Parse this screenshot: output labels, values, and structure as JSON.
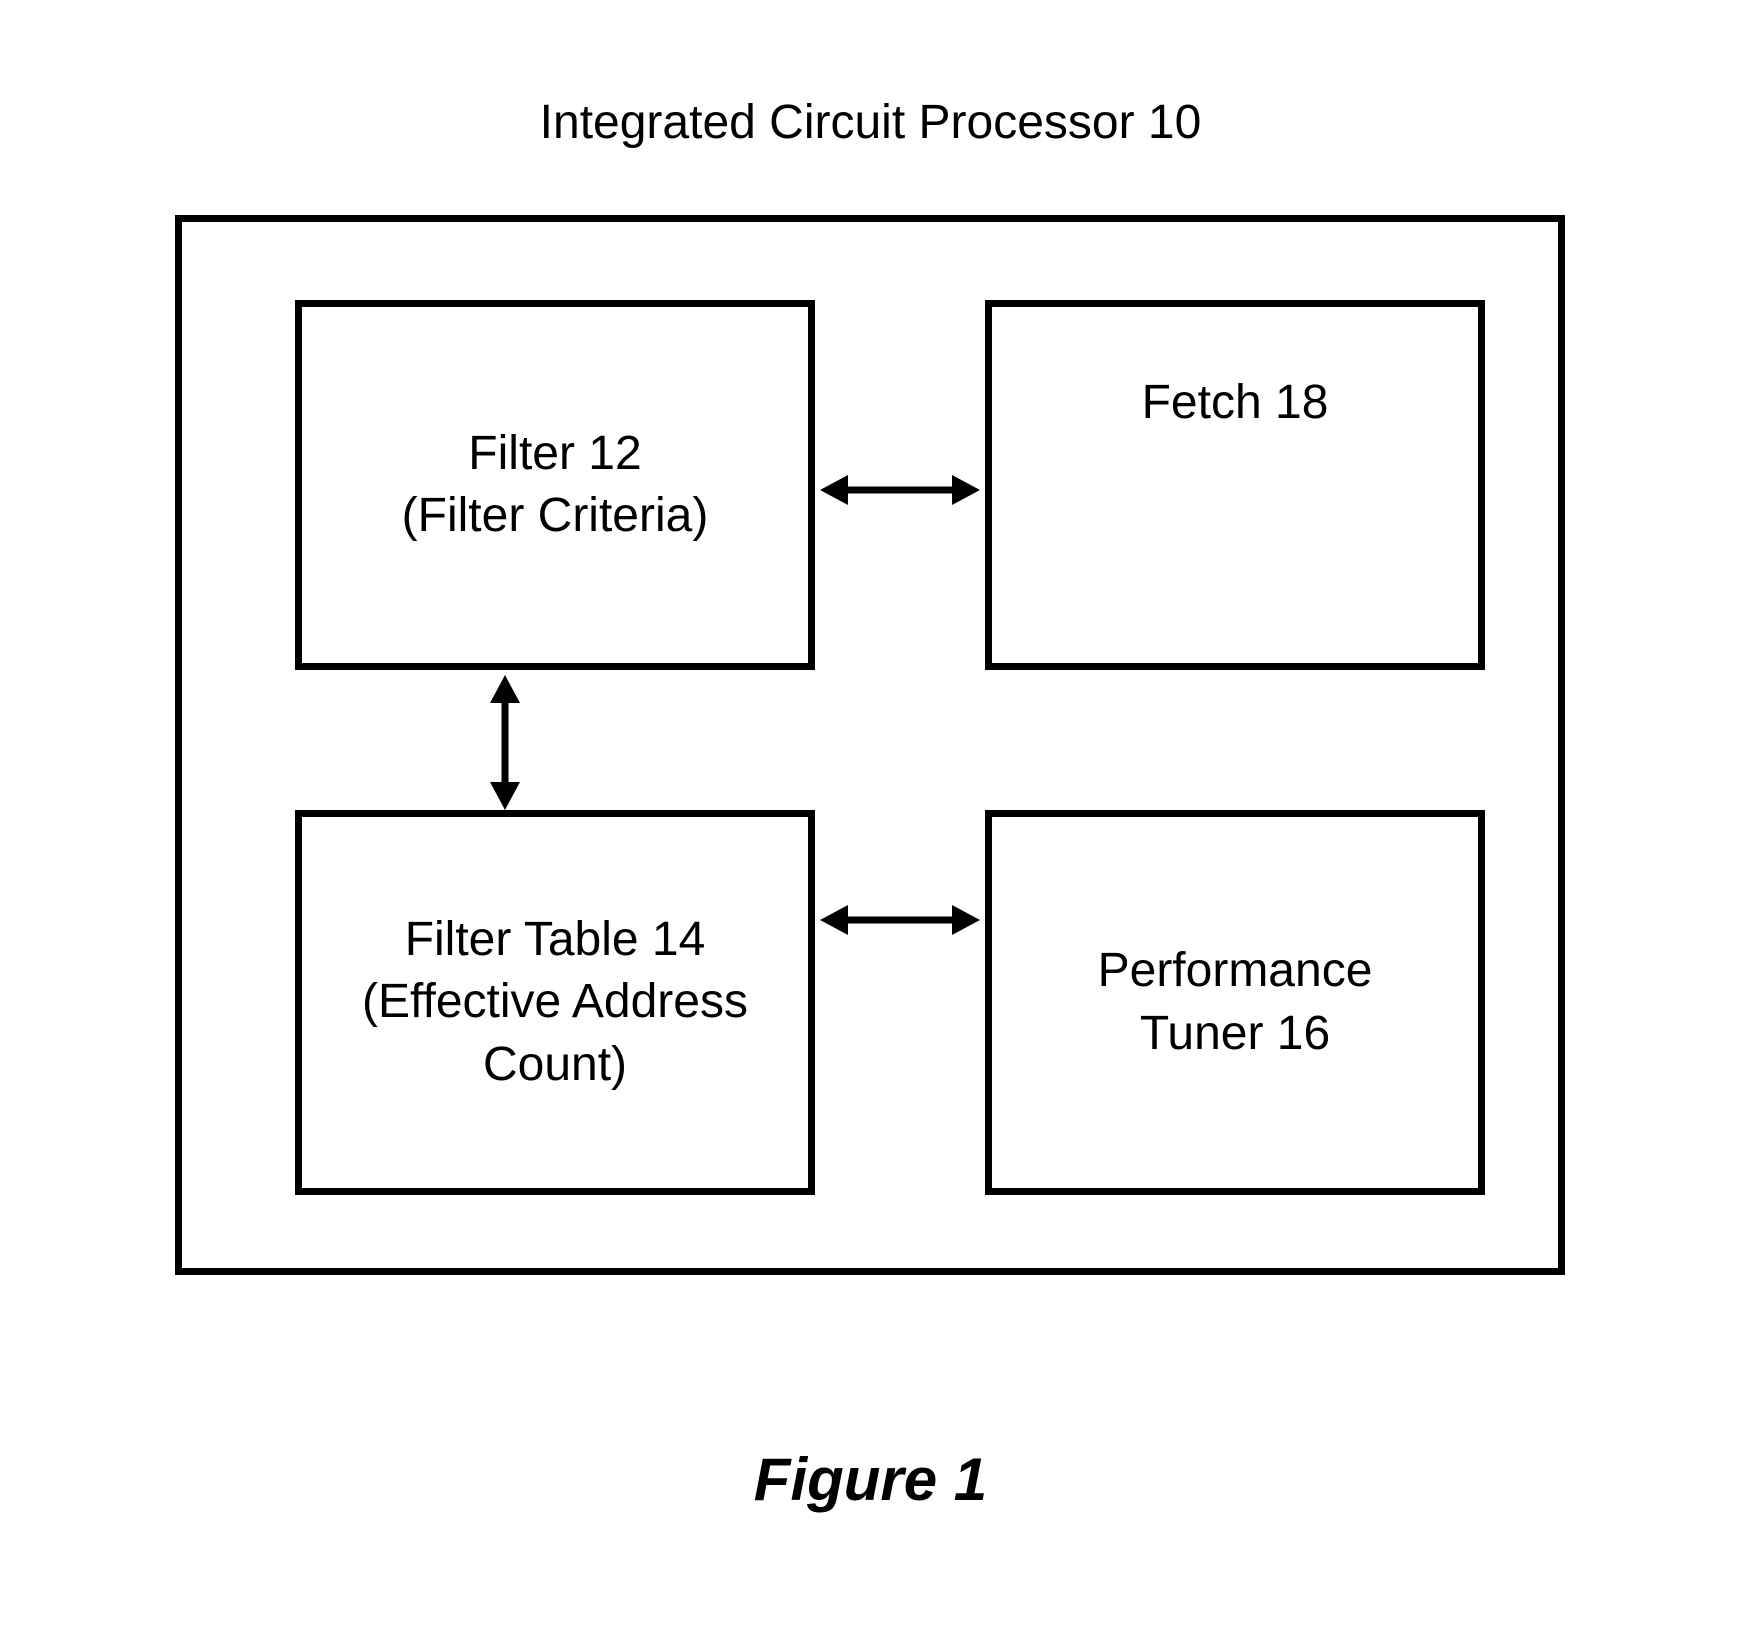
{
  "title": "Integrated Circuit Processor 10",
  "blocks": {
    "filter": {
      "line1": "Filter 12",
      "line2": "(Filter Criteria)"
    },
    "fetch": {
      "line1": "Fetch 18"
    },
    "filterTable": {
      "line1": "Filter Table 14",
      "line2": "(Effective Address",
      "line3": "Count)"
    },
    "performance": {
      "line1": "Performance",
      "line2": "Tuner 16"
    }
  },
  "figureLabel": "Figure 1"
}
